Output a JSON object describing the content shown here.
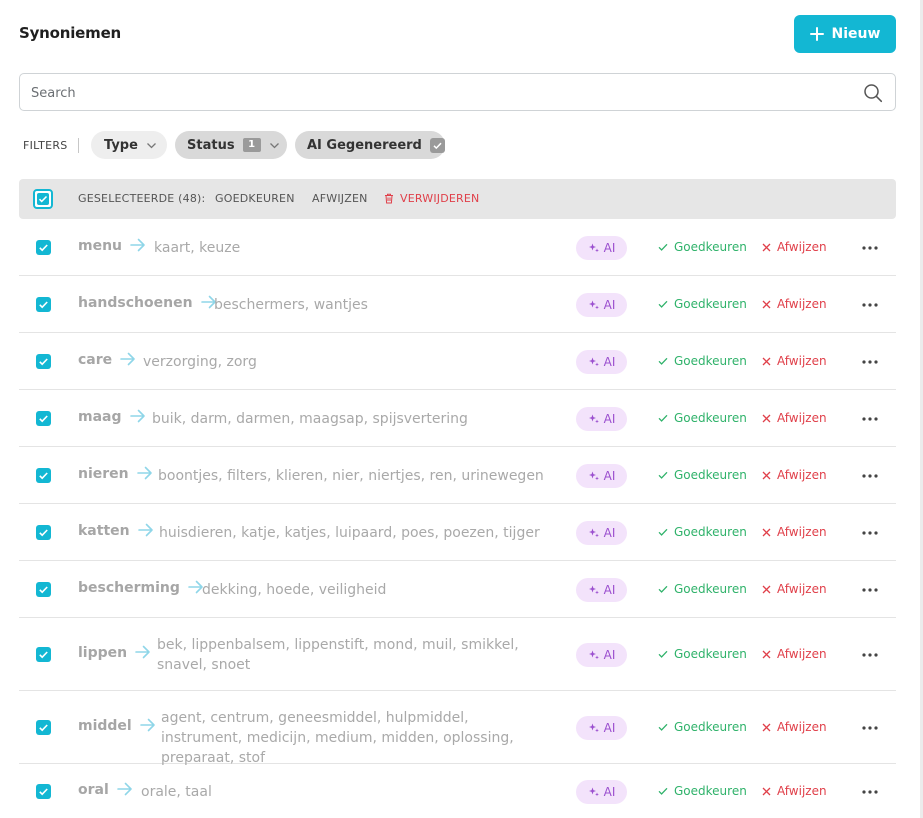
{
  "header": {
    "title": "Synoniemen",
    "new_label": "Nieuw"
  },
  "search": {
    "placeholder": "Search"
  },
  "filters": {
    "label": "FILTERS",
    "type_label": "Type",
    "status_label": "Status",
    "status_count": "1",
    "ai_label": "AI Gegenereerd"
  },
  "selection": {
    "count_label": "GESELECTEERDE (48):",
    "approve_label": "GOEDKEUREN",
    "reject_label": "AFWIJZEN",
    "delete_label": "VERWIJDEREN"
  },
  "row_labels": {
    "ai": "AI",
    "approve": "Goedkeuren",
    "reject": "Afwijzen"
  },
  "colors": {
    "accent": "#13b7d3",
    "approve": "#2fb26a",
    "reject": "#e0404a",
    "ai": "#9b4fcf"
  },
  "rows": [
    {
      "term": "menu",
      "synonyms": "kaart, keuze"
    },
    {
      "term": "handschoenen",
      "synonyms": "beschermers, wantjes"
    },
    {
      "term": "care",
      "synonyms": "verzorging, zorg"
    },
    {
      "term": "maag",
      "synonyms": "buik, darm, darmen, maagsap, spijsvertering"
    },
    {
      "term": "nieren",
      "synonyms": "boontjes, filters, klieren, nier, niertjes, ren, urinewegen"
    },
    {
      "term": "katten",
      "synonyms": "huisdieren, katje, katjes, luipaard, poes, poezen, tijger"
    },
    {
      "term": "bescherming",
      "synonyms": "dekking, hoede, veiligheid"
    },
    {
      "term": "lippen",
      "synonyms": "bek, lippenbalsem, lippenstift, mond, muil, smikkel, snavel, snoet"
    },
    {
      "term": "middel",
      "synonyms": "agent, centrum, geneesmiddel, hulpmiddel, instrument, medicijn, medium, midden, oplossing, preparaat, stof"
    },
    {
      "term": "oral",
      "synonyms": "orale, taal"
    }
  ]
}
